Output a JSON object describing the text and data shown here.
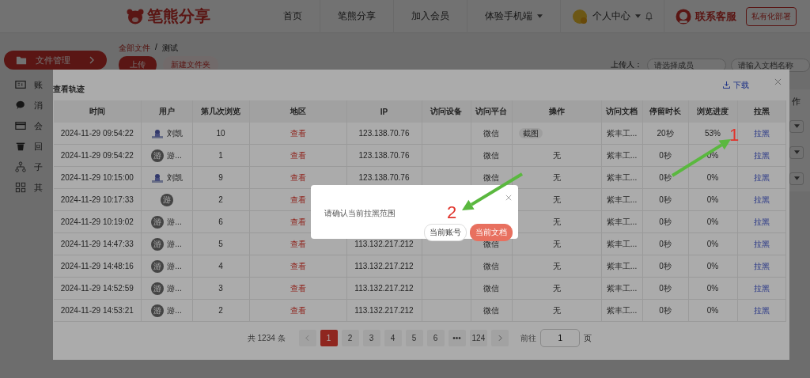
{
  "header": {
    "logo": "笔熊分享",
    "nav": [
      {
        "label": "首页",
        "dropdown": false
      },
      {
        "label": "笔熊分享",
        "dropdown": false
      },
      {
        "label": "加入会员",
        "dropdown": false
      },
      {
        "label": "体验手机端",
        "dropdown": true
      }
    ],
    "user_menu": "个人中心",
    "service": "联系客服",
    "deploy_button": "私有化部署"
  },
  "sidebar": {
    "items": [
      {
        "label": "文件管理",
        "selected": true
      },
      {
        "label": "账",
        "selected": false
      },
      {
        "label": "消",
        "selected": false
      },
      {
        "label": "会",
        "selected": false
      },
      {
        "label": "回",
        "selected": false
      },
      {
        "label": "子",
        "selected": false
      },
      {
        "label": "其",
        "selected": false
      }
    ]
  },
  "breadcrumb": {
    "items": [
      "全部文件",
      "测试"
    ],
    "separator": "/"
  },
  "toolbar": {
    "upload": "上传",
    "new_folder": "新建文件夹",
    "uploader_label": "上传人：",
    "uploader_placeholder": "请选择成员",
    "search_placeholder": "请输入文档名称"
  },
  "file_table": {
    "header_fragment": "作"
  },
  "track_modal": {
    "title": "查看轨迹",
    "download": "下载",
    "columns": [
      "时间",
      "用户",
      "第几次浏览",
      "地区",
      "IP",
      "访问设备",
      "访问平台",
      "操作",
      "访问文档",
      "停留时长",
      "浏览进度",
      "拉黑"
    ],
    "rows": [
      {
        "time": "2024-11-29 09:54:22",
        "user": {
          "kind": "photo",
          "name": "刘凯"
        },
        "view_count": "10",
        "region": "查看",
        "ip": "123.138.70.76",
        "platform": "微信",
        "action": {
          "kind": "tag",
          "text": "截图"
        },
        "document": "紫丰工...",
        "duration": "20秒",
        "progress": "53%",
        "block": "拉黑"
      },
      {
        "time": "2024-11-29 09:54:22",
        "user": {
          "kind": "letter",
          "letter": "游",
          "name": "游..."
        },
        "view_count": "1",
        "region": "查看",
        "ip": "123.138.70.76",
        "platform": "微信",
        "action": {
          "kind": "text",
          "text": "无"
        },
        "document": "紫丰工...",
        "duration": "0秒",
        "progress": "0%",
        "block": "拉黑"
      },
      {
        "time": "2024-11-29 10:15:00",
        "user": {
          "kind": "photo",
          "name": "刘凯"
        },
        "view_count": "9",
        "region": "查看",
        "ip": "123.138.70.76",
        "platform": "微信",
        "action": {
          "kind": "text",
          "text": "无"
        },
        "document": "紫丰工...",
        "duration": "0秒",
        "progress": "0%",
        "block": "拉黑"
      },
      {
        "time": "2024-11-29 10:17:33",
        "user": {
          "kind": "letter",
          "letter": "游"
        },
        "view_count": "2",
        "region": "查看",
        "action": {
          "kind": "text",
          "text": "无"
        },
        "document": "紫丰工...",
        "duration": "0秒",
        "progress": "0%",
        "block": "拉黑"
      },
      {
        "time": "2024-11-29 10:19:02",
        "user": {
          "kind": "letter",
          "letter": "游",
          "name": "游..."
        },
        "view_count": "6",
        "region": "查看",
        "action": {
          "kind": "text",
          "text": "无"
        },
        "document": "紫丰工...",
        "duration": "0秒",
        "progress": "0%",
        "block": "拉黑"
      },
      {
        "time": "2024-11-29 14:47:33",
        "user": {
          "kind": "letter",
          "letter": "游",
          "name": "游..."
        },
        "view_count": "5",
        "region": "查看",
        "ip": "113.132.217.212",
        "platform": "微信",
        "action": {
          "kind": "text",
          "text": "无"
        },
        "document": "紫丰工...",
        "duration": "0秒",
        "progress": "0%",
        "block": "拉黑"
      },
      {
        "time": "2024-11-29 14:48:16",
        "user": {
          "kind": "letter",
          "letter": "游",
          "name": "游..."
        },
        "view_count": "4",
        "region": "查看",
        "ip": "113.132.217.212",
        "platform": "微信",
        "action": {
          "kind": "text",
          "text": "无"
        },
        "document": "紫丰工...",
        "duration": "0秒",
        "progress": "0%",
        "block": "拉黑"
      },
      {
        "time": "2024-11-29 14:52:59",
        "user": {
          "kind": "letter",
          "letter": "游",
          "name": "游..."
        },
        "view_count": "3",
        "region": "查看",
        "ip": "113.132.217.212",
        "platform": "微信",
        "action": {
          "kind": "text",
          "text": "无"
        },
        "document": "紫丰工...",
        "duration": "0秒",
        "progress": "0%",
        "block": "拉黑"
      },
      {
        "time": "2024-11-29 14:53:21",
        "user": {
          "kind": "letter",
          "letter": "游",
          "name": "游..."
        },
        "view_count": "2",
        "region": "查看",
        "ip": "113.132.217.212",
        "platform": "微信",
        "action": {
          "kind": "text",
          "text": "无"
        },
        "document": "紫丰工...",
        "duration": "0秒",
        "progress": "0%",
        "block": "拉黑"
      }
    ],
    "pagination": {
      "total": "共 1234 条",
      "pages": [
        {
          "label": "1",
          "selected": true
        },
        {
          "label": "2",
          "selected": false
        },
        {
          "label": "3",
          "selected": false
        },
        {
          "label": "4",
          "selected": false
        },
        {
          "label": "5",
          "selected": false
        },
        {
          "label": "6",
          "selected": false
        },
        {
          "label": "•••",
          "selected": false
        },
        {
          "label": "124",
          "selected": false
        }
      ],
      "goto_label": "前往",
      "goto_value": "1",
      "page_suffix": "页"
    }
  },
  "confirm_dialog": {
    "message": "请确认当前拉黑范围",
    "buttons": [
      {
        "label": "当前账号",
        "primary": false
      },
      {
        "label": "当前文档",
        "primary": true
      }
    ]
  },
  "annotations": [
    {
      "label": "1"
    },
    {
      "label": "2"
    }
  ]
}
